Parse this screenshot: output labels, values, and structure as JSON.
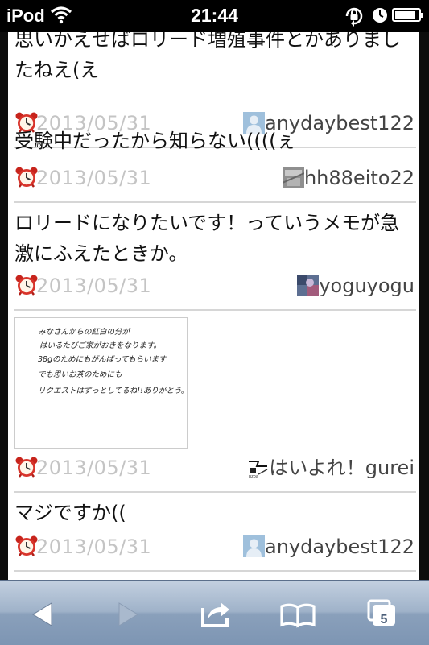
{
  "status_bar": {
    "carrier": "iPod",
    "time": "21:44",
    "battery_level": 0.85
  },
  "comments": [
    {
      "text": "思いかえせばロリード増殖事件とかありましたねえ(え",
      "date": "2013/05/31",
      "user": "anydaybest122",
      "avatar": "person-avatar"
    },
    {
      "text": "受験中だったから知らない((((ぇ",
      "date": "2013/05/31",
      "user": "hh88eito22",
      "avatar": "gray-avatar"
    },
    {
      "text": "ロリードになりたいです！っていうメモが急激にふえたときか。",
      "date": "2013/05/31",
      "user": "yoguyogu",
      "avatar": "photo-avatar"
    },
    {
      "image_text": [
        "みなさんからの紅白の分が",
        "はいるたびご家がおきをなります。",
        "38gのためにもがんばってもらいます",
        "でも思いお茶のためにも",
        "リクエストはずっとしてるね!!ありがとう。"
      ],
      "date": "2013/05/31",
      "user": "はいよれ！gurei",
      "avatar": "sketch-avatar"
    },
    {
      "text": "マジですか((",
      "date": "2013/05/31",
      "user": "anydaybest122",
      "avatar": "person-avatar"
    }
  ],
  "toolbar": {
    "back": "back-icon",
    "forward": "forward-icon",
    "share": "share-icon",
    "bookmarks": "bookmarks-icon",
    "tabs": "tabs-icon",
    "tab_count": "5"
  },
  "colors": {
    "date": "#c4c4c4",
    "alarm": "#d8342b",
    "toolbar": "#9fb2c9"
  }
}
